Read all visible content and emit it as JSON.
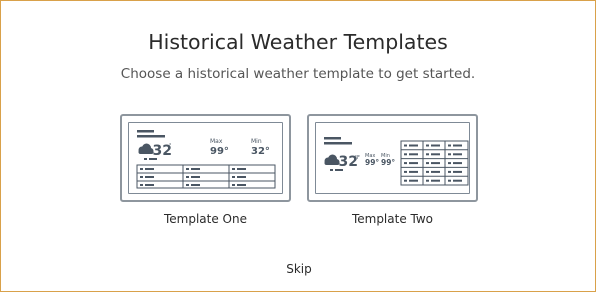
{
  "dialog": {
    "title": "Historical Weather Templates",
    "subtitle": "Choose a historical weather template to get started."
  },
  "templates": [
    {
      "label": "Template One",
      "preview": {
        "temp": "32",
        "unit": "°",
        "max_label": "Max",
        "max_value": "99°",
        "min_label": "Min",
        "min_value": "32°",
        "icon": "cloud-icon"
      }
    },
    {
      "label": "Template Two",
      "preview": {
        "temp": "32",
        "unit": "°F",
        "max_label": "Max",
        "max_value": "99°",
        "min_label": "Min",
        "min_value": "99°",
        "icon": "cloud-icon"
      }
    }
  ],
  "skip_label": "Skip",
  "colors": {
    "border_accent": "#d9a14a",
    "preview_stroke": "#4a5663",
    "card_border": "#8e969e"
  }
}
